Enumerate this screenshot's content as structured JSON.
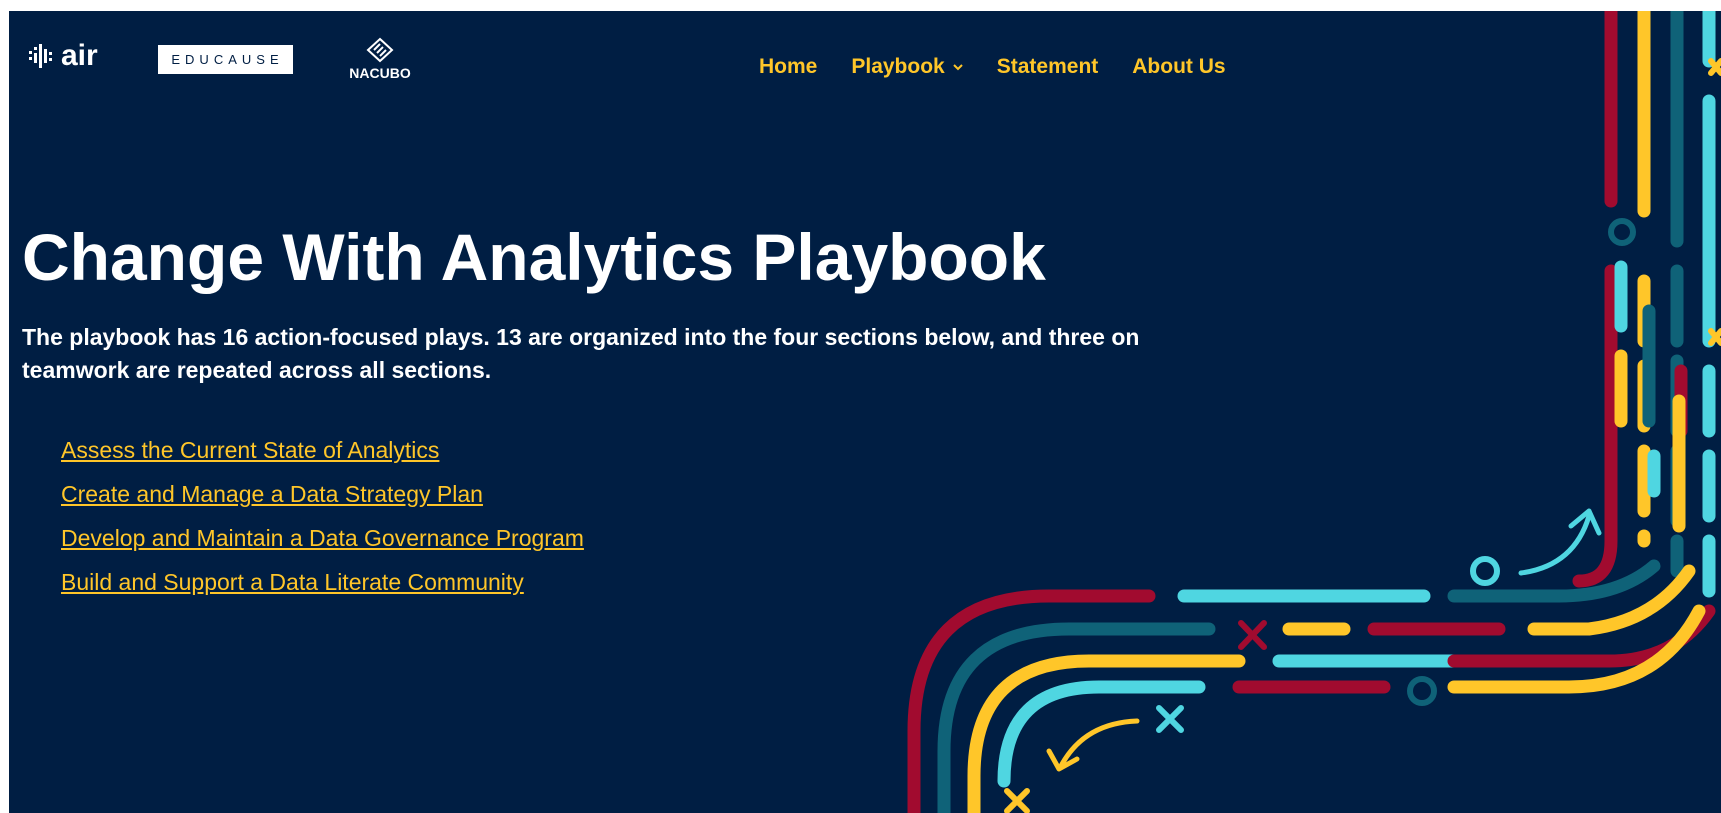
{
  "header": {
    "logos": {
      "air": "air",
      "educause": "EDUCAUSE",
      "nacubo": "NACUBO"
    },
    "nav": [
      {
        "label": "Home"
      },
      {
        "label": "Playbook",
        "has_dropdown": true
      },
      {
        "label": "Statement"
      },
      {
        "label": "About Us"
      }
    ]
  },
  "hero": {
    "title": "Change With Analytics Playbook",
    "description": "The playbook has 16 action-focused plays. 13 are organized into the four sections below, and three on teamwork are repeated across all sections."
  },
  "sections": [
    {
      "label": "Assess the Current State of Analytics"
    },
    {
      "label": "Create and Manage a Data Strategy Plan"
    },
    {
      "label": "Develop and Maintain a Data Governance Program"
    },
    {
      "label": "Build and Support a Data Literate Community"
    }
  ],
  "colors": {
    "background": "#001e43",
    "accent": "#ffc629",
    "text": "#ffffff",
    "decor_red": "#a10b2f",
    "decor_teal": "#0f6278",
    "decor_cyan": "#4fd6e1",
    "decor_yellow": "#ffc629"
  }
}
